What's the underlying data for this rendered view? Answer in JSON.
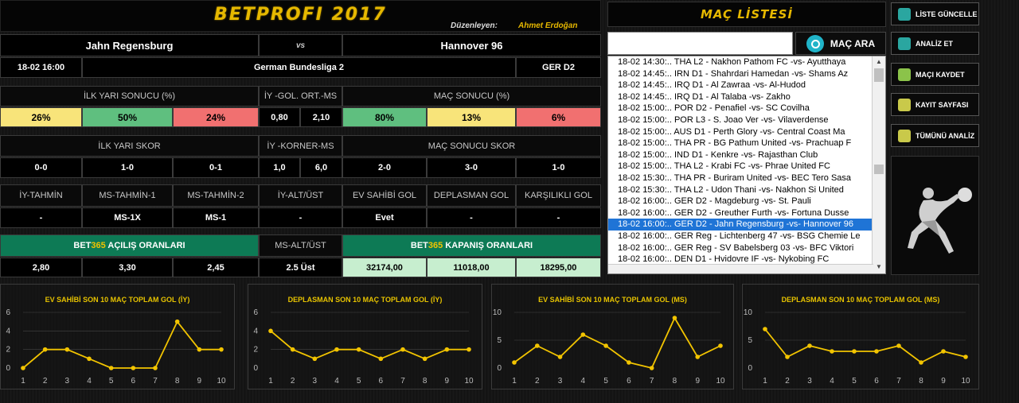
{
  "app": {
    "title": "BETPROFI 2017",
    "author_label": "Düzenleyen:",
    "author_name": "Ahmet Erdoğan"
  },
  "match": {
    "home": "Jahn Regensburg",
    "vs": "vs",
    "away": "Hannover 96",
    "datetime": "18-02 16:00",
    "league": "German Bundesliga 2",
    "league_code": "GER D2"
  },
  "first_half": {
    "header": "İLK YARI SONUCU (%)",
    "values": [
      "26%",
      "50%",
      "24%"
    ],
    "goal_avg_header": "İY -GOL. ORT.-MS",
    "goal_avg": [
      "0,80",
      "2,10"
    ]
  },
  "full_time": {
    "header": "MAÇ SONUCU (%)",
    "values": [
      "80%",
      "13%",
      "6%"
    ]
  },
  "ht_score": {
    "header": "İLK YARI SKOR",
    "values": [
      "0-0",
      "1-0",
      "0-1"
    ],
    "corner_header": "İY -KORNER-MS",
    "corners": [
      "1,0",
      "6,0"
    ]
  },
  "ft_score": {
    "header": "MAÇ SONUCU SKOR",
    "values": [
      "2-0",
      "3-0",
      "1-0"
    ]
  },
  "predictions": {
    "headers": [
      "İY-TAHMİN",
      "MS-TAHMİN-1",
      "MS-TAHMİN-2",
      "İY-ALT/ÜST",
      "EV SAHİBİ GOL",
      "DEPLASMAN GOL",
      "KARŞILIKLI GOL"
    ],
    "values": [
      "-",
      "MS-1X",
      "MS-1",
      "-",
      "Evet",
      "-",
      "-"
    ]
  },
  "odds": {
    "open_prefix": "BET",
    "brand": "365",
    "open_suffix": " AÇILIŞ ORANLARI",
    "open_values": [
      "2,80",
      "3,30",
      "2,45"
    ],
    "ou_header": "MS-ALT/ÜST",
    "ou_value": "2.5 Üst",
    "close_prefix": "BET",
    "close_suffix": " KAPANIŞ ORANLARI",
    "close_values": [
      "32174,00",
      "11018,00",
      "18295,00"
    ]
  },
  "match_list": {
    "header": "MAÇ LİSTESİ",
    "search_button": "MAÇ ARA",
    "items": [
      "18-02 14:30:.. THA L2 - Nakhon Pathom FC -vs- Ayutthaya",
      "18-02 14:45:.. IRN D1 - Shahrdari Hamedan -vs- Shams Az",
      "18-02 14:45:.. IRQ D1 - Al Zawraa -vs- Al-Hudod",
      "18-02 14:45:.. IRQ D1 - Al Talaba -vs- Zakho",
      "18-02 15:00:.. POR D2 - Penafiel -vs- SC Covilha",
      "18-02 15:00:.. POR L3 - S. Joao Ver -vs- Vilaverdense",
      "18-02 15:00:.. AUS D1 - Perth Glory -vs- Central Coast Ma",
      "18-02 15:00:.. THA PR - BG Pathum United -vs- Prachuap F",
      "18-02 15:00:.. IND D1 - Kenkre -vs- Rajasthan Club",
      "18-02 15:00:.. THA L2 - Krabi FC -vs- Phrae United FC",
      "18-02 15:30:.. THA PR - Buriram United -vs- BEC Tero Sasa",
      "18-02 15:30:.. THA L2 - Udon Thani -vs- Nakhon Si United",
      "18-02 16:00:.. GER D2 - Magdeburg -vs- St. Pauli",
      "18-02 16:00:.. GER D2 - Greuther Furth -vs- Fortuna Dusse",
      "18-02 16:00:.. GER D2 - Jahn Regensburg -vs- Hannover 96",
      "18-02 16:00:.. GER Reg - Lichtenberg 47 -vs- BSG Chemie Le",
      "18-02 16:00:.. GER Reg - SV Babelsberg 03 -vs- BFC Viktori",
      "18-02 16:00:.. DEN D1 - Hvidovre IF -vs- Nykobing FC",
      "18-02 16:00:.. DEN D1 - Hvidovre IF -vs- Nykobing FC"
    ],
    "selected_index": 14
  },
  "side_buttons": [
    {
      "label": "LİSTE GÜNCELLE",
      "icon": "refresh-icon",
      "color": "#2aa6a0"
    },
    {
      "label": "ANALİZ ET",
      "icon": "analyze-icon",
      "color": "#2aa6a0"
    },
    {
      "label": "MAÇI KAYDET",
      "icon": "save-icon",
      "color": "#8bc34a"
    },
    {
      "label": "KAYIT SAYFASI",
      "icon": "record-icon",
      "color": "#c9c94a"
    },
    {
      "label": "TÜMÜNÜ ANALİZ",
      "icon": "analyze-all-icon",
      "color": "#c9c94a"
    }
  ],
  "colors": {
    "accent": "#e6c200",
    "line": "#f2c400"
  },
  "chart_data": [
    {
      "type": "line",
      "title": "EV SAHİBİ SON 10 MAÇ TOPLAM GOL (İY)",
      "x": [
        1,
        2,
        3,
        4,
        5,
        6,
        7,
        8,
        9,
        10
      ],
      "y": [
        0,
        2,
        2,
        1,
        0,
        0,
        0,
        5,
        2,
        2
      ],
      "yticks": [
        0,
        2,
        4,
        6
      ],
      "ylim": [
        0,
        6
      ]
    },
    {
      "type": "line",
      "title": "DEPLASMAN SON 10 MAÇ TOPLAM GOL (İY)",
      "x": [
        1,
        2,
        3,
        4,
        5,
        6,
        7,
        8,
        9,
        10
      ],
      "y": [
        4,
        2,
        1,
        2,
        2,
        1,
        2,
        1,
        2,
        2
      ],
      "yticks": [
        0,
        2,
        4,
        6
      ],
      "ylim": [
        0,
        6
      ]
    },
    {
      "type": "line",
      "title": "EV SAHİBİ SON 10 MAÇ TOPLAM GOL (MS)",
      "x": [
        1,
        2,
        3,
        4,
        5,
        6,
        7,
        8,
        9,
        10
      ],
      "y": [
        1,
        4,
        2,
        6,
        4,
        1,
        0,
        9,
        2,
        4
      ],
      "yticks": [
        0,
        5,
        10
      ],
      "ylim": [
        0,
        10
      ]
    },
    {
      "type": "line",
      "title": "DEPLASMAN SON 10 MAÇ TOPLAM GOL (MS)",
      "x": [
        1,
        2,
        3,
        4,
        5,
        6,
        7,
        8,
        9,
        10
      ],
      "y": [
        7,
        2,
        4,
        3,
        3,
        3,
        4,
        1,
        3,
        2
      ],
      "yticks": [
        0,
        5,
        10
      ],
      "ylim": [
        0,
        10
      ]
    }
  ]
}
